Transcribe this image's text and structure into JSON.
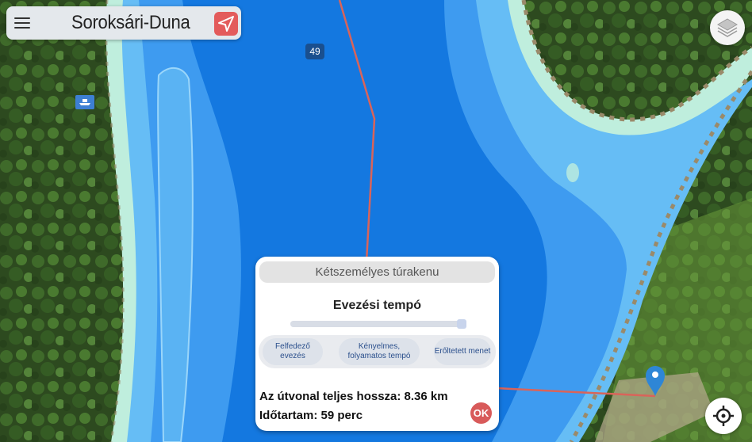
{
  "header": {
    "title": "Soroksári-Duna",
    "menu_icon": "hamburger-menu-icon",
    "nav_icon": "navigation-arrow-icon"
  },
  "map": {
    "km_marker": "49",
    "colors": {
      "deep_water": "#1478e0",
      "mid_water": "#3e9bf0",
      "shallow_water": "#66bdf5",
      "shore": "#bfeedd",
      "route": "#d9645a",
      "pin": "#2e86d6"
    }
  },
  "controls": {
    "layers_icon": "layers-icon",
    "locate_icon": "crosshair-locate-icon"
  },
  "panel": {
    "boat_type": "Kétszemélyes túrakenu",
    "pace_label": "Evezési tempó",
    "pace_level": 1.0,
    "pace_options": [
      "Felfedező evezés",
      "Kényelmes, folyamatos tempó",
      "Erőltetett menet"
    ],
    "distance_text": "Az útvonal teljes hossza: 8.36 km",
    "duration_text": "Időtartam: 59 perc",
    "ok_label": "OK"
  }
}
